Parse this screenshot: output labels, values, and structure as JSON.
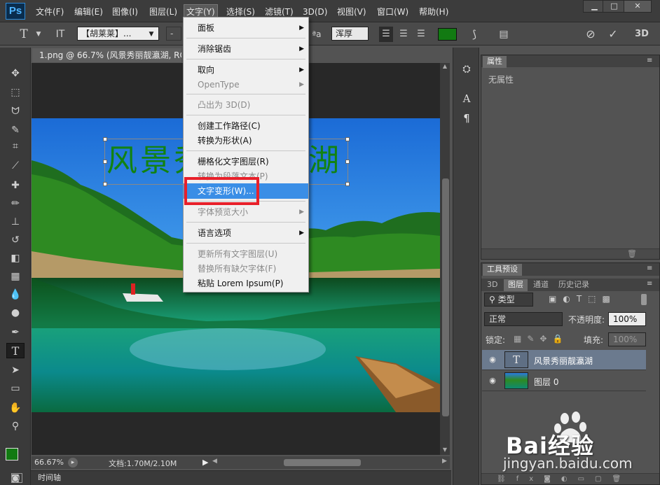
{
  "app": {
    "logo": "Ps"
  },
  "menubar": {
    "items": [
      "文件(F)",
      "编辑(E)",
      "图像(I)",
      "图层(L)",
      "文字(Y)",
      "选择(S)",
      "滤镜(T)",
      "3D(D)",
      "视图(V)",
      "窗口(W)",
      "帮助(H)"
    ],
    "active_index": 4,
    "window_buttons": {
      "minimize": "▁",
      "maximize": "□",
      "close": "✕"
    }
  },
  "options": {
    "tool_icon": "T",
    "orientation_icon": "IT",
    "font_family": "【胡莱莱】...",
    "font_size": "-",
    "aa_label": "ªa",
    "antialias": "浑厚",
    "color": "#127a12",
    "threed": "3D"
  },
  "document": {
    "tab_title": "1.png @ 66.7% (风景秀丽靓瀛湖, RGB",
    "caption": "风景秀丽靓瀛湖",
    "caption_color": "#128212"
  },
  "status": {
    "zoom": "66.67%",
    "doc_info": "文档:1.70M/2.10M",
    "timeline": "时间轴"
  },
  "type_menu": {
    "items": [
      {
        "label": "面板",
        "submenu": true,
        "disabled": false
      },
      {
        "label": "消除锯齿",
        "submenu": true,
        "disabled": false
      },
      {
        "label": "取向",
        "submenu": true,
        "disabled": false
      },
      {
        "label": "OpenType",
        "submenu": true,
        "disabled": true
      },
      {
        "label": "凸出为 3D(D)",
        "submenu": false,
        "disabled": true
      },
      {
        "label": "创建工作路径(C)",
        "submenu": false,
        "disabled": false
      },
      {
        "label": "转换为形状(A)",
        "submenu": false,
        "disabled": false
      },
      {
        "label": "栅格化文字图层(R)",
        "submenu": false,
        "disabled": false
      },
      {
        "label": "转换为段落文本(P)",
        "submenu": false,
        "disabled": true
      },
      {
        "label": "文字变形(W)...",
        "submenu": false,
        "disabled": false,
        "highlighted": true
      },
      {
        "label": "字体预览大小",
        "submenu": true,
        "disabled": true
      },
      {
        "label": "语言选项",
        "submenu": true,
        "disabled": false
      },
      {
        "label": "更新所有文字图层(U)",
        "submenu": false,
        "disabled": true
      },
      {
        "label": "替换所有缺欠字体(F)",
        "submenu": false,
        "disabled": true
      },
      {
        "label": "粘贴 Lorem Ipsum(P)",
        "submenu": false,
        "disabled": false
      }
    ]
  },
  "properties_panel": {
    "tab": "属性",
    "empty_text": "无属性"
  },
  "tool_presets_panel": {
    "tab": "工具预设"
  },
  "layers_panel": {
    "tabs": [
      "3D",
      "图层",
      "通道",
      "历史记录"
    ],
    "active_tab": 1,
    "filter_kind": "类型",
    "blend_mode": "正常",
    "opacity_label": "不透明度:",
    "opacity_value": "100%",
    "lock_label": "锁定:",
    "fill_label": "填充:",
    "fill_value": "100%",
    "layers": [
      {
        "name": "风景秀丽靓瀛湖",
        "type": "text",
        "selected": true,
        "visible": true
      },
      {
        "name": "图层 0",
        "type": "image",
        "selected": false,
        "visible": true
      }
    ],
    "footer_icons": [
      "link-icon",
      "fx-icon",
      "mask-icon",
      "adjustment-icon",
      "folder-icon",
      "new-layer-icon",
      "trash-icon"
    ]
  },
  "watermark": {
    "brand": "Bai经验",
    "url": "jingyan.baidu.com"
  }
}
